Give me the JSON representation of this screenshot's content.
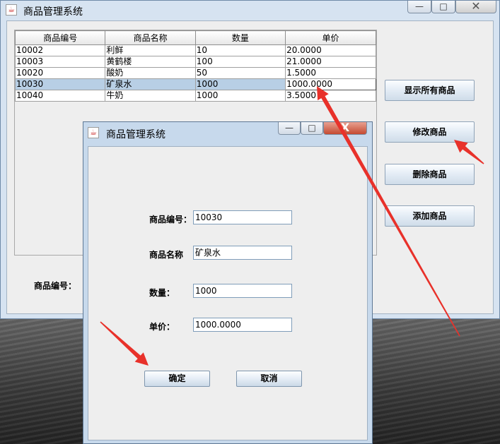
{
  "main_window": {
    "title": "商品管理系统",
    "minimize": "—",
    "maximize": "□",
    "close": "✕"
  },
  "table": {
    "columns": [
      "商品编号",
      "商品名称",
      "数量",
      "单价"
    ],
    "rows": [
      [
        "10002",
        "利鲜",
        "10",
        "20.0000"
      ],
      [
        "10003",
        "黄鹤楼",
        "100",
        "21.0000"
      ],
      [
        "10020",
        "酸奶",
        "50",
        "1.5000"
      ],
      [
        "10030",
        "矿泉水",
        "1000",
        "1000.0000"
      ],
      [
        "10040",
        "牛奶",
        "1000",
        "3.5000"
      ]
    ],
    "selected_row": 3
  },
  "buttons": {
    "show_all": "显示所有商品",
    "modify": "修改商品",
    "delete": "删除商品",
    "add": "添加商品"
  },
  "bottom_label": "商品编号：",
  "dialog": {
    "title": "商品管理系统",
    "minimize": "—",
    "maximize": "□",
    "close": "X",
    "fields": {
      "id_label": "商品编号：",
      "id_value": "10030",
      "name_label": "商品名称",
      "name_value": "矿泉水",
      "qty_label": "数量：",
      "qty_value": "1000",
      "price_label": "单价：",
      "price_value": "1000.0000"
    },
    "ok": "确定",
    "cancel": "取消"
  },
  "colors": {
    "arrow": "#e8312a",
    "selected_row": "#b8cfe5"
  }
}
